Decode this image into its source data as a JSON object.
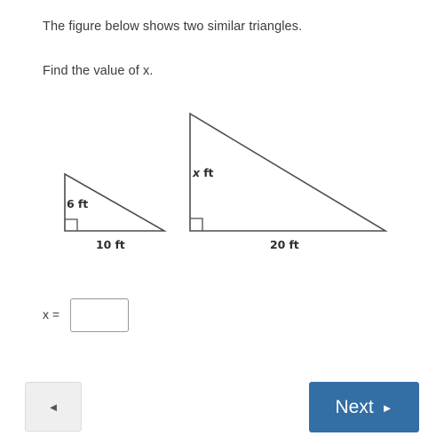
{
  "question": {
    "line1": "The figure below shows two similar triangles.",
    "line2": "Find the value of x."
  },
  "figure": {
    "description": "Two similar right triangles",
    "stroke_color": "#4d4d4d",
    "triangles": [
      {
        "name": "small-triangle",
        "apex": [
          73,
          196
        ],
        "right_angle_vertex": [
          73,
          260
        ],
        "base_end": [
          185,
          260
        ],
        "height_label": "6 ft",
        "base_label": "10 ft"
      },
      {
        "name": "large-triangle",
        "apex": [
          214,
          128
        ],
        "right_angle_vertex": [
          214,
          260
        ],
        "base_end": [
          434,
          260
        ],
        "height_label": "x ft",
        "height_label_variable": "x",
        "height_label_unit": " ft",
        "base_label": "20 ft"
      }
    ]
  },
  "answer": {
    "label": "x =",
    "value": "",
    "placeholder": ""
  },
  "footer": {
    "back_label": "◄",
    "next_label": "Next",
    "next_arrow": "►",
    "next_color": "#336ea5",
    "back_color": "#efefef"
  }
}
